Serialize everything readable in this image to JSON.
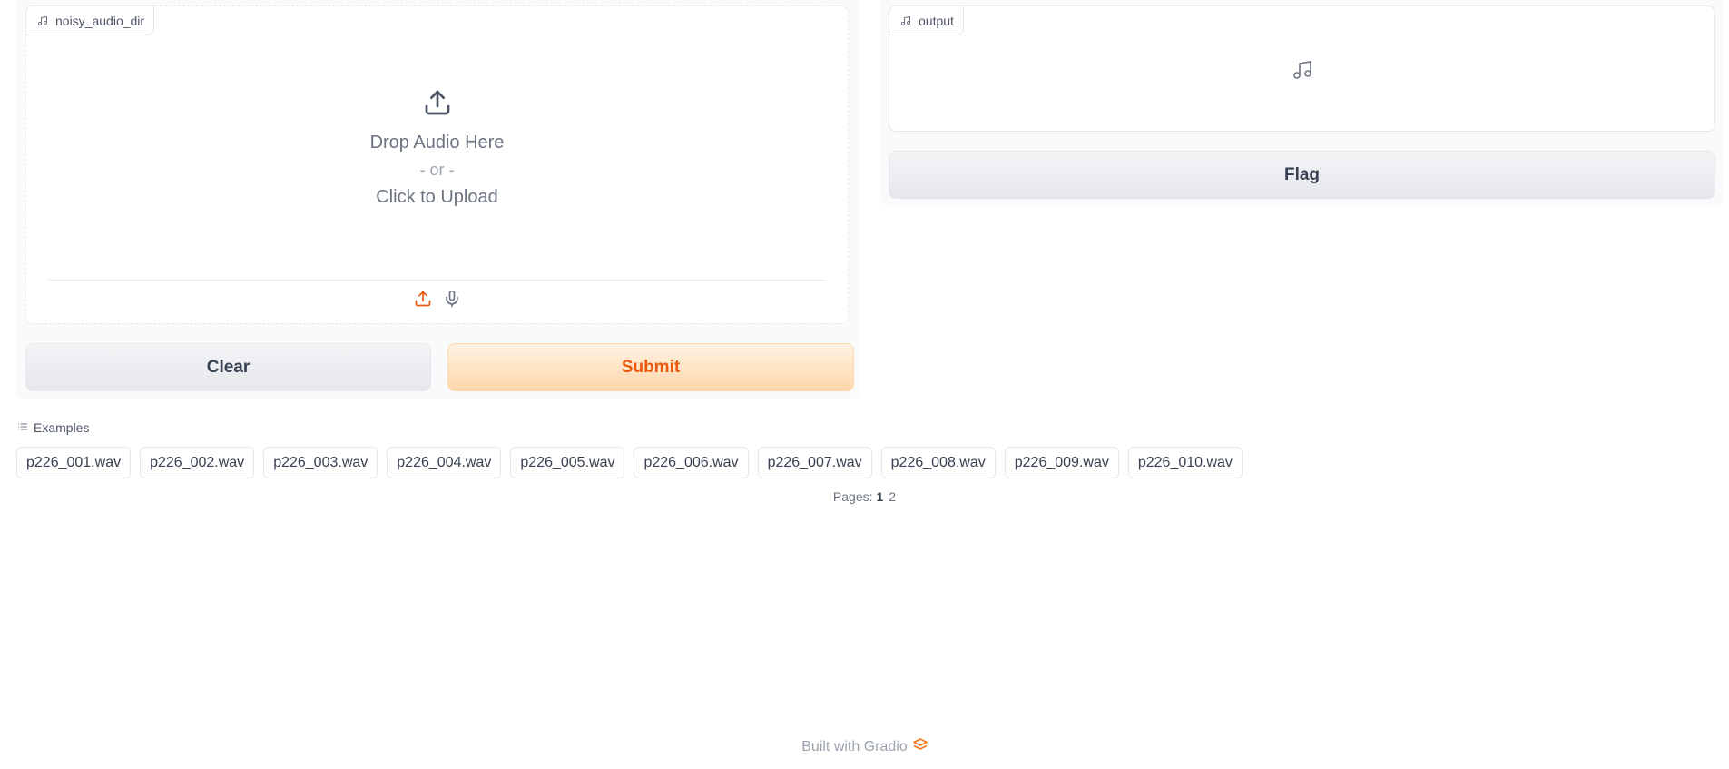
{
  "input": {
    "label": "noisy_audio_dir",
    "drop_text": "Drop Audio Here",
    "or_text": "- or -",
    "upload_text": "Click to Upload",
    "icons": [
      "music-note",
      "upload",
      "microphone"
    ]
  },
  "output": {
    "label": "output",
    "icon": "music-note"
  },
  "buttons": {
    "clear": "Clear",
    "submit": "Submit",
    "flag": "Flag"
  },
  "examples": {
    "title": "Examples",
    "items": [
      "p226_001.wav",
      "p226_002.wav",
      "p226_003.wav",
      "p226_004.wav",
      "p226_005.wav",
      "p226_006.wav",
      "p226_007.wav",
      "p226_008.wav",
      "p226_009.wav",
      "p226_010.wav"
    ]
  },
  "pagination": {
    "label": "Pages:",
    "current": "1",
    "other": "2"
  },
  "footer": {
    "text": "Built with Gradio"
  },
  "colors": {
    "accent": "#ea580c",
    "accent_bg": "#fed7aa",
    "panel_bg": "#f9fafb",
    "border": "#e5e7eb"
  }
}
